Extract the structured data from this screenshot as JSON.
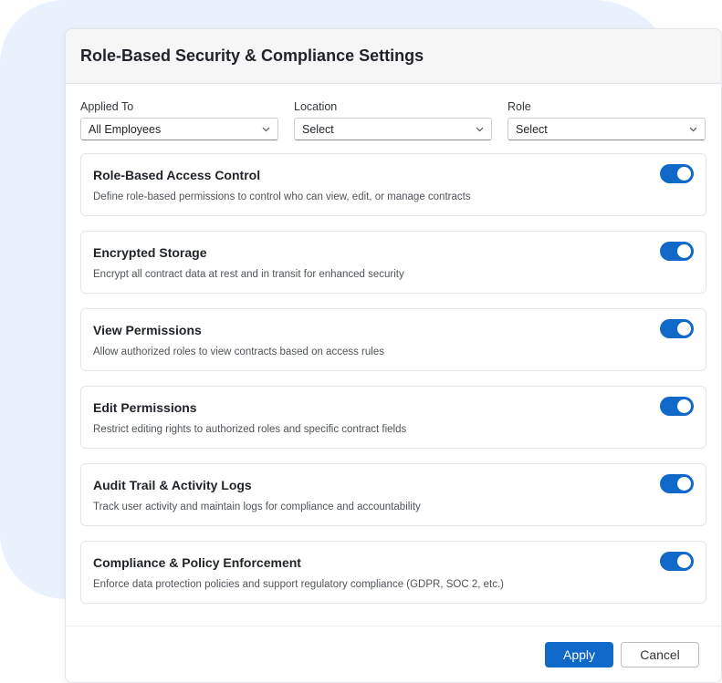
{
  "dialog": {
    "title": "Role-Based Security & Compliance Settings"
  },
  "filters": [
    {
      "label": "Applied To",
      "value": "All Employees"
    },
    {
      "label": "Location",
      "value": "Select"
    },
    {
      "label": "Role",
      "value": "Select"
    }
  ],
  "settings": [
    {
      "title": "Role-Based Access Control",
      "description": "Define role-based permissions to control who can view, edit, or manage contracts",
      "enabled": true
    },
    {
      "title": "Encrypted Storage",
      "description": "Encrypt all contract data at rest and in transit for enhanced security",
      "enabled": true
    },
    {
      "title": "View Permissions",
      "description": "Allow authorized roles to view contracts based on access rules",
      "enabled": true
    },
    {
      "title": "Edit Permissions",
      "description": "Restrict editing rights to authorized roles and specific contract fields",
      "enabled": true
    },
    {
      "title": "Audit Trail & Activity Logs",
      "description": "Track user activity and maintain logs for compliance and accountability",
      "enabled": true
    },
    {
      "title": "Compliance & Policy Enforcement",
      "description": "Enforce data protection policies and support regulatory compliance (GDPR, SOC 2, etc.)",
      "enabled": true
    }
  ],
  "footer": {
    "apply_label": "Apply",
    "cancel_label": "Cancel"
  },
  "colors": {
    "accent": "#1068c9",
    "background_blob": "#e8f1fd"
  },
  "icons": {
    "dropdown": "chevron-down-icon"
  }
}
